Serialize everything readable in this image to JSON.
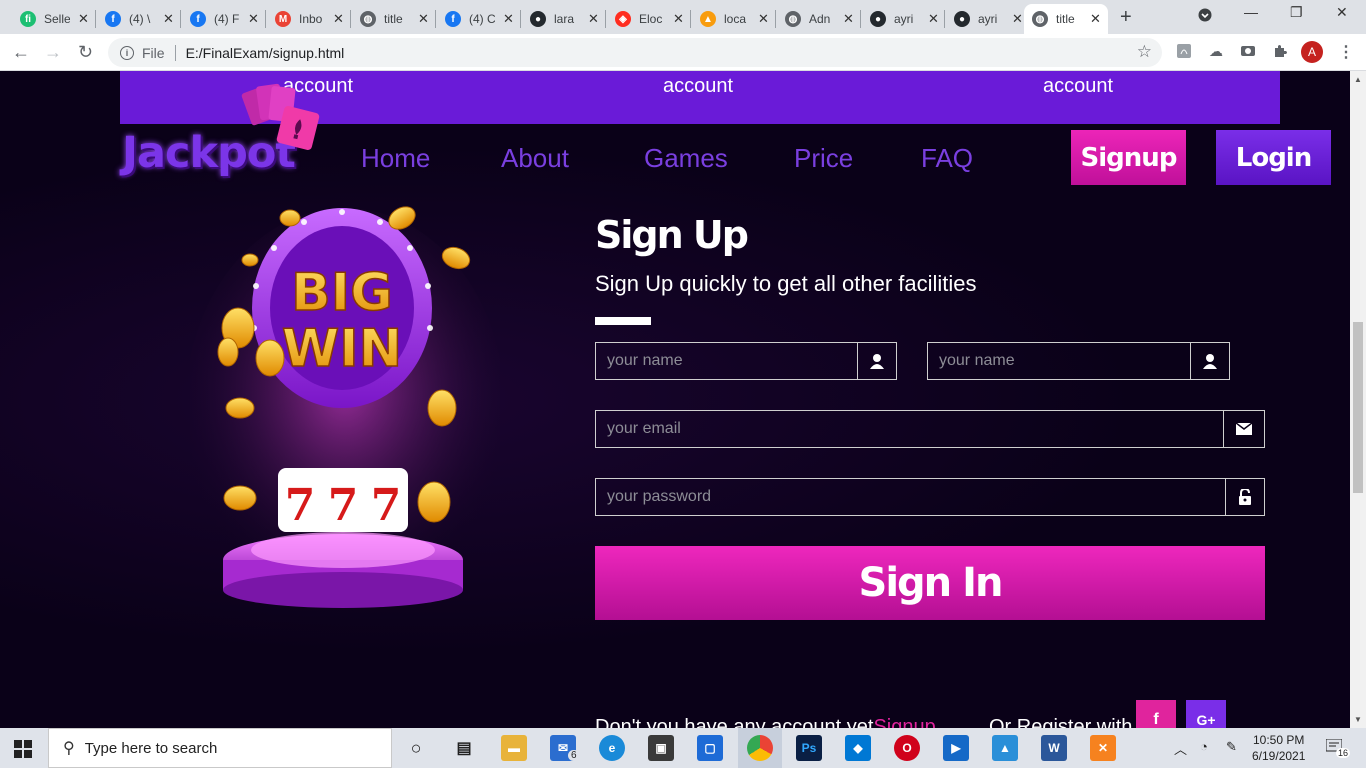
{
  "browser": {
    "tabs": [
      {
        "label": "Selle",
        "icon": "fiverr-icon",
        "color": "#1dbf73",
        "glyph": "fi"
      },
      {
        "label": "(4) \\",
        "icon": "facebook-icon",
        "color": "#1877f2",
        "glyph": "f"
      },
      {
        "label": "(4) F",
        "icon": "facebook-icon",
        "color": "#1877f2",
        "glyph": "f"
      },
      {
        "label": "Inbo",
        "icon": "gmail-icon",
        "color": "#ea4335",
        "glyph": "M"
      },
      {
        "label": "title",
        "icon": "globe-icon",
        "color": "#5f6368",
        "glyph": "◍"
      },
      {
        "label": "(4) C",
        "icon": "facebook-icon",
        "color": "#1877f2",
        "glyph": "f"
      },
      {
        "label": "lara",
        "icon": "github-icon",
        "color": "#24292e",
        "glyph": "●"
      },
      {
        "label": "Eloc",
        "icon": "laravel-icon",
        "color": "#ff2d20",
        "glyph": "◈"
      },
      {
        "label": "loca",
        "icon": "phpmyadmin-icon",
        "color": "#f89c0e",
        "glyph": "▲"
      },
      {
        "label": "Adn",
        "icon": "globe-icon",
        "color": "#5f6368",
        "glyph": "◍"
      },
      {
        "label": "ayri",
        "icon": "github-icon",
        "color": "#24292e",
        "glyph": "●"
      },
      {
        "label": "ayri",
        "icon": "github-icon",
        "color": "#24292e",
        "glyph": "●"
      },
      {
        "label": "title",
        "icon": "globe-icon",
        "color": "#5f6368",
        "glyph": "◍"
      }
    ],
    "address": {
      "info": "i",
      "scheme": "File",
      "url": "E:/FinalExam/signup.html"
    },
    "profile_initial": "A"
  },
  "page": {
    "account_labels": [
      "account",
      "account",
      "account"
    ],
    "logo": "Jackpot",
    "nav": [
      "Home",
      "About",
      "Games",
      "Price",
      "FAQ"
    ],
    "signup_button": "Signup",
    "login_button": "Login",
    "hero": {
      "line1": "BIG",
      "line2": "WIN",
      "reels": [
        "7",
        "7",
        "7"
      ]
    },
    "form": {
      "title": "Sign Up",
      "subtitle": "Sign Up quickly to get all other facilities",
      "first_name_placeholder": "your name",
      "last_name_placeholder": "your name",
      "email_placeholder": "your email",
      "password_placeholder": "your password",
      "submit": "Sign In"
    },
    "footer": {
      "no_account_text": "Don't you have any account yet",
      "signup_link": "Signup",
      "register_with": "Or Register with",
      "facebook": "f",
      "google": "G+"
    },
    "colors": {
      "purple": "#6a1bd8",
      "pink": "#e0249d",
      "background": "#0a0118"
    }
  },
  "taskbar": {
    "search_placeholder": "Type here to search",
    "clock_time": "10:50 PM",
    "clock_date": "6/19/2021",
    "notifications": "16",
    "mail_badge": "6"
  }
}
